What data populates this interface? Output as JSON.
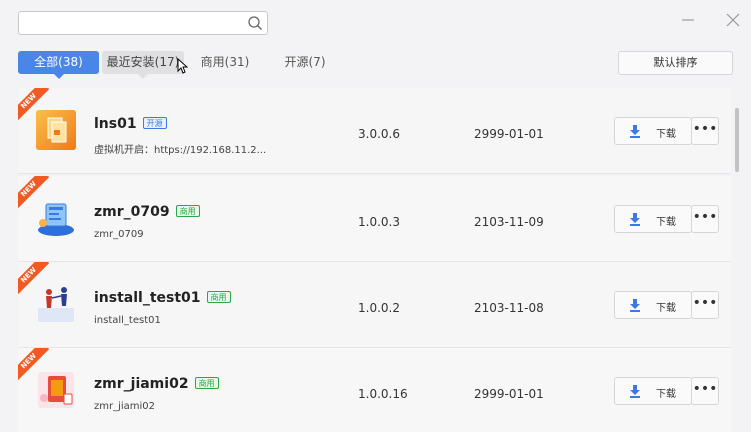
{
  "search": {
    "value": "",
    "placeholder": ""
  },
  "tabs": [
    {
      "label": "全部(38)"
    },
    {
      "label": "最近安装(17)"
    },
    {
      "label": "商用(31)"
    },
    {
      "label": "开源(7)"
    }
  ],
  "sort_label": "默认排序",
  "new_label": "NEW",
  "download_label": "下载",
  "more_label": "•••",
  "apps": [
    {
      "name": "lns01",
      "badge": "开源",
      "desc": "虚拟机开启：https://192.168.11.2...",
      "version": "3.0.0.6",
      "date": "2999-01-01"
    },
    {
      "name": "zmr_0709",
      "badge": "商用",
      "desc": "zmr_0709",
      "version": "1.0.0.3",
      "date": "2103-11-09"
    },
    {
      "name": "install_test01",
      "badge": "商用",
      "desc": "install_test01",
      "version": "1.0.0.2",
      "date": "2103-11-08"
    },
    {
      "name": "zmr_jiami02",
      "badge": "商用",
      "desc": "zmr_jiami02",
      "version": "1.0.0.16",
      "date": "2999-01-01"
    }
  ],
  "colors": {
    "accent": "#4a86e8",
    "new_ribbon": "#f15a22",
    "badge_open": "#3b7ae4",
    "badge_commercial": "#29a745"
  },
  "icons": {
    "search": "search-icon",
    "minimize": "minimize-icon",
    "close": "close-icon",
    "download": "download-arrow-icon"
  }
}
